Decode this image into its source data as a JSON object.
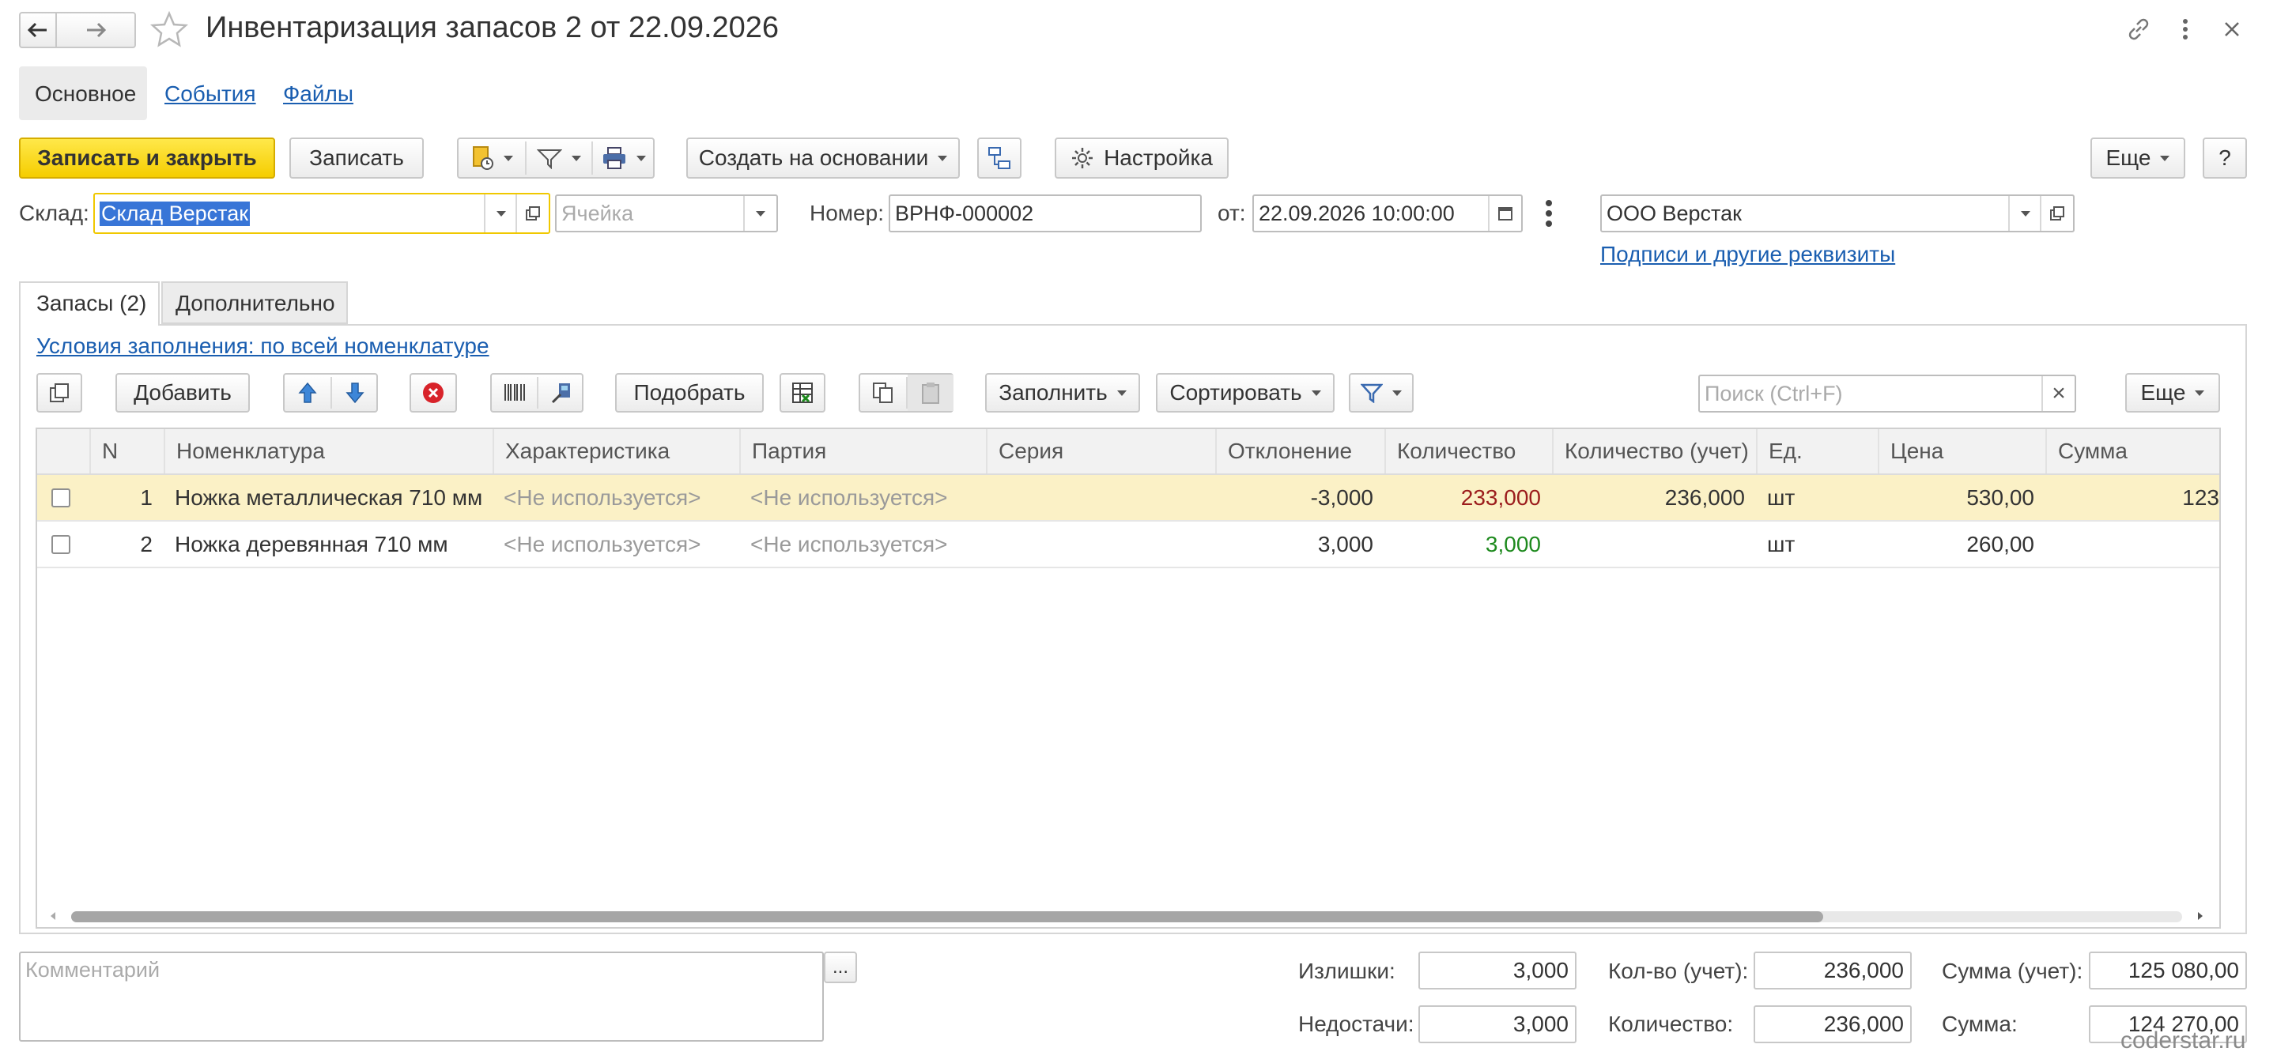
{
  "window": {
    "title": "Инвентаризация запасов 2 от 22.09.2026",
    "link_icon": "link-icon",
    "more_icon": "more-vertical-icon",
    "close_icon": "close-icon"
  },
  "nav_tabs": {
    "main": "Основное",
    "events": "События",
    "files": "Файлы"
  },
  "toolbar": {
    "save_close": "Записать и закрыть",
    "save": "Записать",
    "create_based": "Создать на основании",
    "settings": "Настройка",
    "more": "Еще",
    "help": "?"
  },
  "header_fields": {
    "warehouse_label": "Склад:",
    "warehouse_value": "Склад Верстак",
    "cell_placeholder": "Ячейка",
    "number_label": "Номер:",
    "number_value": "ВРНФ-000002",
    "date_label": "от:",
    "date_value": "22.09.2026 10:00:00",
    "org_value": "ООО Верстак",
    "signatures_link": "Подписи и другие реквизиты"
  },
  "inner_tabs": {
    "stock": "Запасы (2)",
    "additional": "Дополнительно"
  },
  "fill_conditions": "Условия заполнения: по всей номенклатуре",
  "table_toolbar": {
    "add": "Добавить",
    "pick": "Подобрать",
    "fill": "Заполнить",
    "sort": "Сортировать",
    "search_placeholder": "Поиск (Ctrl+F)",
    "clear": "×",
    "more": "Еще"
  },
  "table": {
    "columns": [
      "N",
      "Номенклатура",
      "Характеристика",
      "Партия",
      "Серия",
      "Отклонение",
      "Количество",
      "Количество (учет)",
      "Ед.",
      "Цена",
      "Сумма"
    ],
    "rows": [
      {
        "n": "1",
        "item": "Ножка металлическая 710 мм",
        "characteristic": "<Не используется>",
        "batch": "<Не используется>",
        "series": "",
        "deviation": "-3,000",
        "qty": "233,000",
        "qty_account": "236,000",
        "unit": "шт",
        "price": "530,00",
        "sum": "123"
      },
      {
        "n": "2",
        "item": "Ножка деревянная 710 мм",
        "characteristic": "<Не используется>",
        "batch": "<Не используется>",
        "series": "",
        "deviation": "3,000",
        "qty": "3,000",
        "qty_account": "",
        "unit": "шт",
        "price": "260,00",
        "sum": ""
      }
    ]
  },
  "footer": {
    "comment_placeholder": "Комментарий",
    "comment_btn": "...",
    "surplus_label": "Излишки:",
    "surplus_value": "3,000",
    "shortage_label": "Недостачи:",
    "shortage_value": "3,000",
    "qty_account_label": "Кол-во (учет):",
    "qty_account_value": "236,000",
    "qty_label": "Количество:",
    "qty_value": "236,000",
    "sum_account_label": "Сумма (учет):",
    "sum_account_value": "125 080,00",
    "sum_label": "Сумма:",
    "sum_value": "124 270,00"
  },
  "watermark": "coderstar.ru",
  "colors": {
    "accent_yellow": "#f5cd00",
    "link_blue": "#1a5eb0",
    "qty_red": "#9b1c1c",
    "qty_green": "#1e8a1e",
    "selected_row": "#fbf1c6"
  }
}
